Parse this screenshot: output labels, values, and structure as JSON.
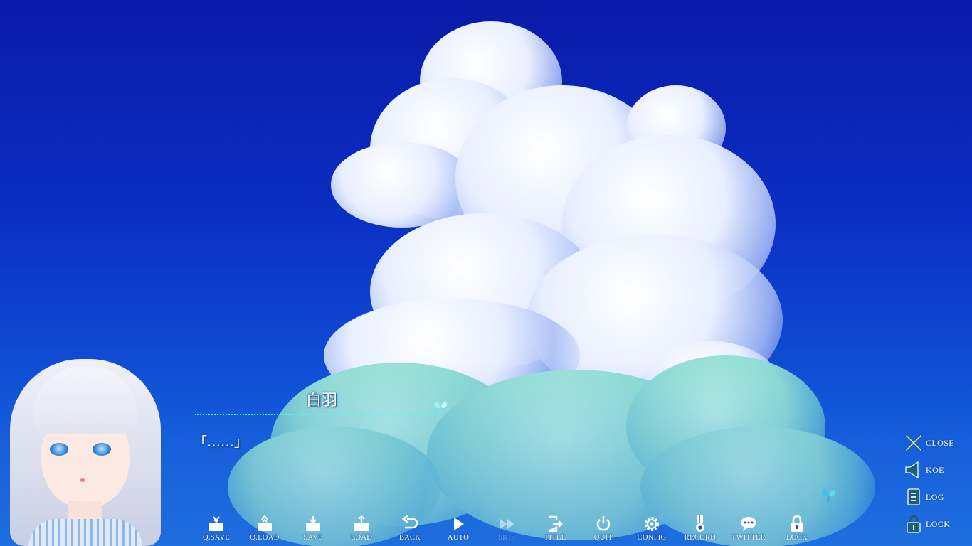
{
  "dialogue": {
    "speaker": "白羽",
    "text": "「……」"
  },
  "toolbar": {
    "buttons": [
      {
        "label": "Q.SAVE",
        "icon": "quick-save-icon",
        "enabled": true
      },
      {
        "label": "Q.LOAD",
        "icon": "quick-load-icon",
        "enabled": true
      },
      {
        "label": "SAVE",
        "icon": "save-icon",
        "enabled": true
      },
      {
        "label": "LOAD",
        "icon": "load-icon",
        "enabled": true
      },
      {
        "label": "BACK",
        "icon": "back-icon",
        "enabled": true
      },
      {
        "label": "AUTO",
        "icon": "play-icon",
        "enabled": true
      },
      {
        "label": "SKIP",
        "icon": "fast-forward-icon",
        "enabled": false
      },
      {
        "label": "TITLE",
        "icon": "exit-door-icon",
        "enabled": true
      },
      {
        "label": "QUIT",
        "icon": "power-icon",
        "enabled": true
      },
      {
        "label": "CONFIG",
        "icon": "gear-icon",
        "enabled": true
      },
      {
        "label": "RECORD",
        "icon": "medal-icon",
        "enabled": true
      },
      {
        "label": "TWITTER",
        "icon": "speech-bubble-icon",
        "enabled": true
      },
      {
        "label": "LOCK",
        "icon": "lock-icon",
        "enabled": true
      }
    ]
  },
  "side_panel": {
    "close_label": "CLOSE",
    "koe_label": "KOE",
    "log_label": "LOG",
    "lock_label": "LOCK"
  },
  "colors": {
    "accent": "#5ef2e8",
    "icon_fill": "#ffffff",
    "side_icon": "#1f5f7a"
  }
}
